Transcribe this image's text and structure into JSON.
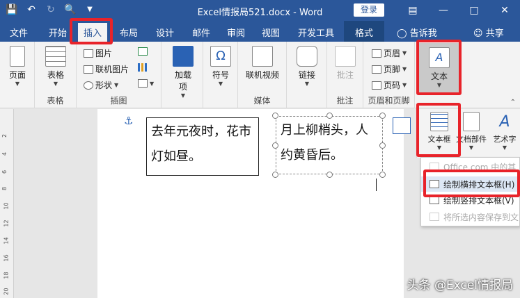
{
  "window": {
    "title": "Excel情报局521.docx  -  Word",
    "login_label": "登录"
  },
  "tabs": {
    "file": "文件",
    "home": "开始",
    "insert": "插入",
    "layout": "布局",
    "design": "设计",
    "mail": "邮件",
    "review": "审阅",
    "view": "视图",
    "developer": "开发工具",
    "format": "格式",
    "tellme": "告诉我",
    "share": "共享"
  },
  "ribbon": {
    "pages": {
      "btn": "页面",
      "label": ""
    },
    "tables": {
      "btn": "表格",
      "label": "表格"
    },
    "illus": {
      "picture": "图片",
      "online_picture": "联机图片",
      "shapes": "形状",
      "label": "插图"
    },
    "addins": {
      "btn_line1": "加载",
      "btn_line2": "项"
    },
    "symbols": {
      "btn": "符号"
    },
    "media": {
      "btn": "联机视频",
      "label": "媒体"
    },
    "links": {
      "btn": "链接"
    },
    "comments": {
      "btn": "批注",
      "label": "批注"
    },
    "header_footer": {
      "header": "页眉",
      "footer": "页脚",
      "page_number": "页码",
      "label": "页眉和页脚"
    },
    "text": {
      "btn": "文本"
    }
  },
  "subribbon": {
    "textbox": "文本框",
    "quickparts": "文档部件",
    "wordart": "艺术字"
  },
  "dropdown": {
    "office_more": "Office.com 中的其",
    "draw_horizontal": "绘制横排文本框(H)",
    "draw_vertical": "绘制竖排文本框(V)",
    "save_selection": "将所选内容保存到文"
  },
  "document": {
    "textbox1": "去年元夜时，花市灯如昼。",
    "textbox2": "月上柳梢头，人约黄昏后。"
  },
  "ruler": [
    "2",
    "4",
    "6",
    "8",
    "10",
    "12",
    "14",
    "16",
    "18",
    "20"
  ],
  "watermark": "头条 @Excel情报局",
  "colors": {
    "titlebar": "#2b579a",
    "highlight": "#e8232a"
  }
}
